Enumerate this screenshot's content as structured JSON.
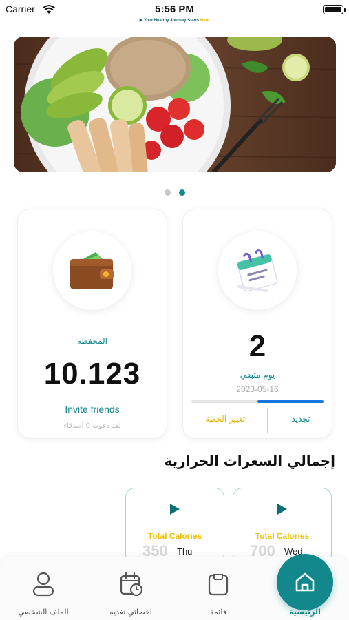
{
  "status_bar": {
    "carrier": "Carrier",
    "time": "5:56 PM",
    "tagline_main": "Your Healthy Journey Starts",
    "tagline_accent": "Here"
  },
  "banner": {
    "active_slide": 2,
    "slide_count": 2
  },
  "wallet_card": {
    "label": "المحفظة",
    "value": "10.123",
    "invite_label": "Invite friends",
    "invite_note": "لقد دعوت 0 أصدقاء"
  },
  "plan_card": {
    "days_value": "2",
    "days_label": "يوم متبقي",
    "date": "2023-05-16",
    "progress_fraction": 0.5,
    "renew_label": "تجديد",
    "change_plan_label": "تغيير الخطة"
  },
  "calories_section": {
    "title": "إجمالي السعرات الحرارية",
    "cards": [
      {
        "title": "Total Calories",
        "value": "700",
        "day": "Wed"
      },
      {
        "title": "Total Calories",
        "value": "350",
        "day": "Thu"
      }
    ]
  },
  "bottom_nav": {
    "profile": "الملف الشخصي",
    "nutritionist": "اخصائي تغذيه",
    "list": "قائمة",
    "home": "الرئيسية"
  },
  "colors": {
    "accent": "#12888d",
    "gold": "#f2c200",
    "progress": "#1477e0"
  }
}
